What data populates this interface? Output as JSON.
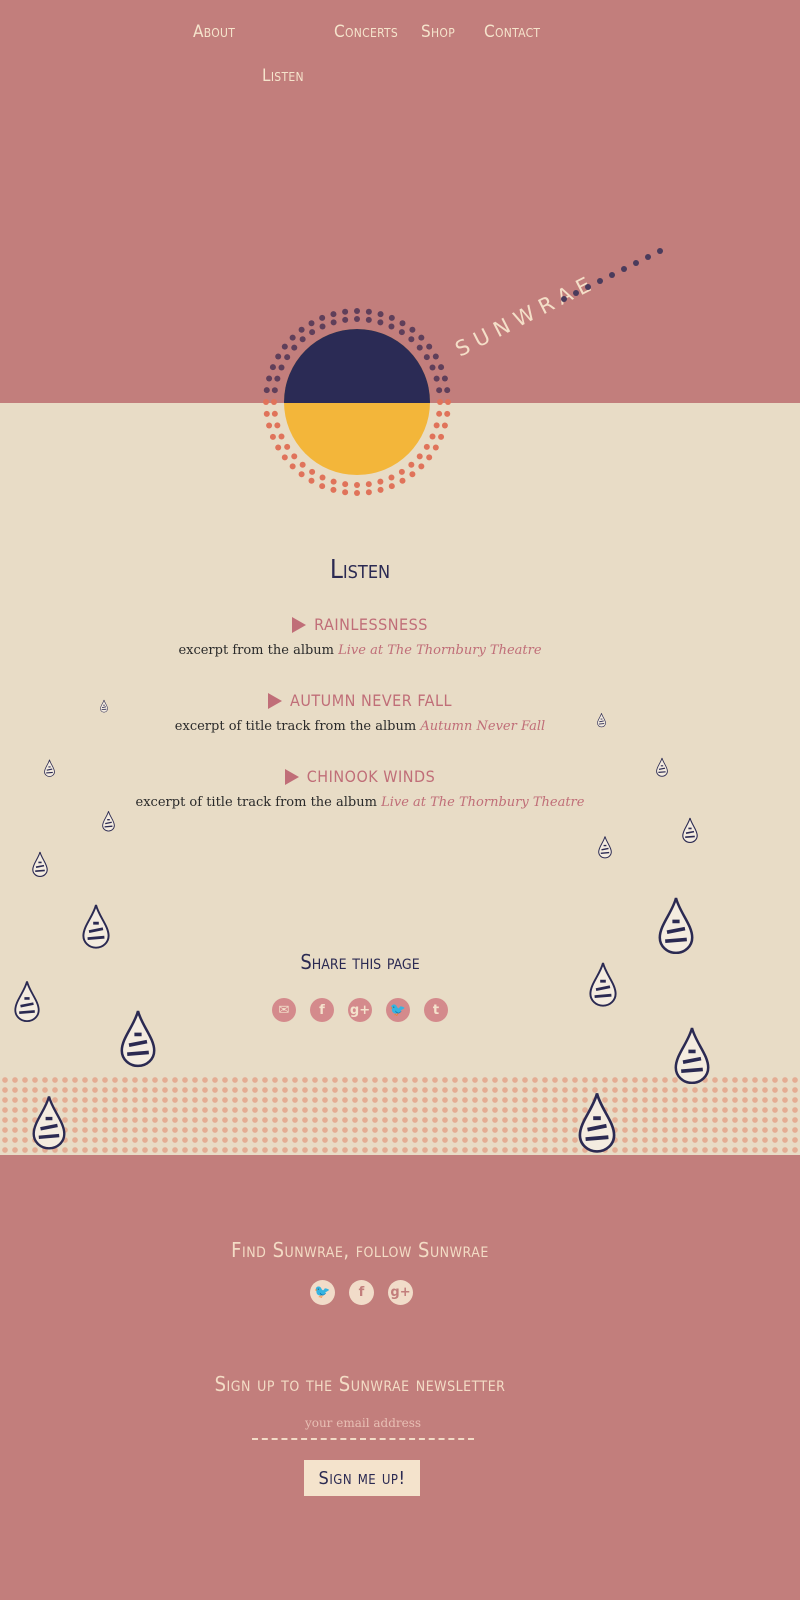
{
  "nav": {
    "about": "About",
    "concerts": "Concerts",
    "shop": "Shop",
    "contact": "Contact",
    "listen": "Listen"
  },
  "logo": {
    "text": "SUNWRAE"
  },
  "listen": {
    "heading": "Listen",
    "tracks": [
      {
        "title": "Rainlessness",
        "desc": "excerpt from the album ",
        "album": "Live at The Thornbury Theatre"
      },
      {
        "title": "Autumn Never Fall",
        "desc": "excerpt of title track from the album ",
        "album": "Autumn Never Fall"
      },
      {
        "title": "Chinook Winds",
        "desc": "excerpt of title track from the album ",
        "album": "Live at The Thornbury Theatre"
      }
    ]
  },
  "share": {
    "heading": "Share this page",
    "icons": [
      "email-icon",
      "facebook-icon",
      "google-plus-icon",
      "twitter-icon",
      "tumblr-icon"
    ]
  },
  "follow": {
    "heading": "Find Sunwrae, follow Sunwrae",
    "icons": [
      "twitter-icon",
      "facebook-icon",
      "google-plus-icon"
    ]
  },
  "newsletter": {
    "heading": "Sign up to the Sunwrae newsletter",
    "placeholder": "your email address",
    "button": "Sign me up!"
  },
  "colors": {
    "rose": "#c27e7c",
    "cream": "#e8dcc6",
    "navy": "#2b2a52",
    "sun": "#f3b63a"
  }
}
